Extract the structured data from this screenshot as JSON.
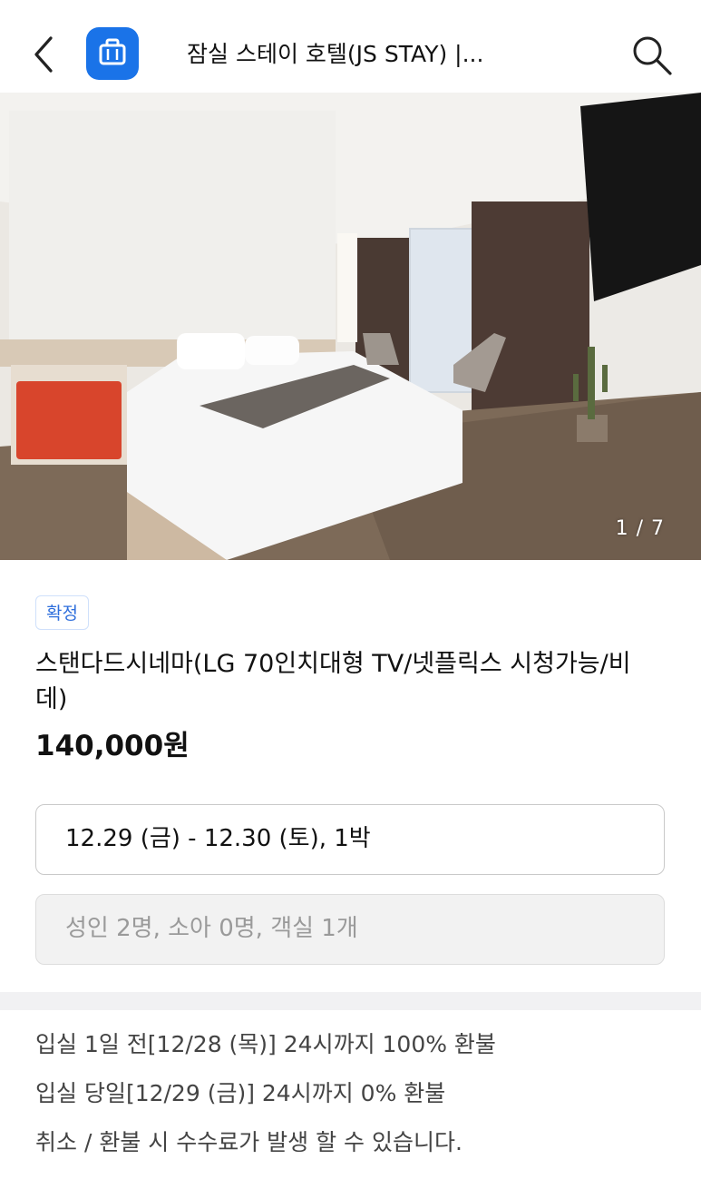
{
  "header": {
    "title": "잠실 스테이 호텔(JS STAY) |...",
    "back_icon": "chevron-left-icon",
    "app_icon": "briefcase-icon",
    "search_icon": "search-icon"
  },
  "gallery": {
    "counter": "1 / 7"
  },
  "room": {
    "status_badge": "확정",
    "name": "스탠다드시네마(LG 70인치대형 TV/넷플릭스 시청가능/비데)",
    "price": "140,000원"
  },
  "booking": {
    "dates": "12.29 (금) - 12.30 (토), 1박",
    "guests": "성인 2명, 소아 0명, 객실 1개"
  },
  "policy": {
    "lines": [
      "입실 1일 전[12/28 (목)] 24시까지 100% 환불",
      "입실 당일[12/29 (금)] 24시까지 0% 환불",
      "취소 / 환불 시 수수료가 발생 할 수 있습니다."
    ]
  },
  "colors": {
    "accent": "#1a73e8",
    "badge_text": "#2f6fdc",
    "divider": "#f1f1f3"
  }
}
